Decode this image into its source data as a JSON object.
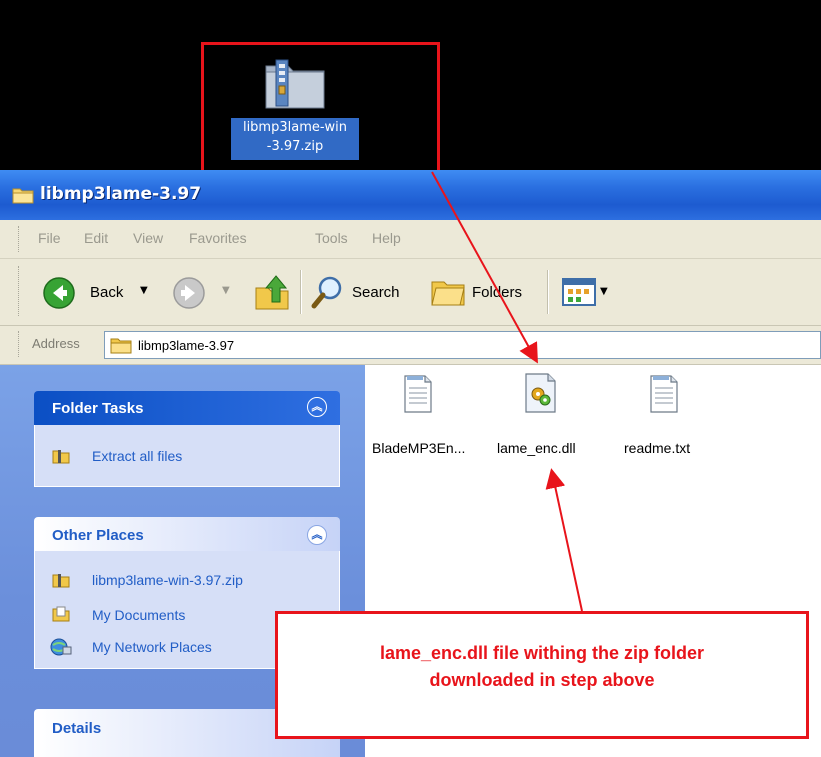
{
  "desktop": {
    "zip_label_line1": "libmp3lame-win",
    "zip_label_line2": "-3.97.zip"
  },
  "window": {
    "title": "libmp3lame-3.97",
    "menu": [
      "File",
      "Edit",
      "View",
      "Favorites",
      "Tools",
      "Help"
    ],
    "toolbar": {
      "back_label": "Back",
      "search_label": "Search",
      "folders_label": "Folders"
    },
    "address": {
      "label": "Address",
      "value": "libmp3lame-3.97"
    }
  },
  "taskpane": {
    "folder_tasks": {
      "title": "Folder Tasks",
      "items": [
        "Extract all files"
      ]
    },
    "other_places": {
      "title": "Other Places",
      "items": [
        "libmp3lame-win-3.97.zip",
        "My Documents",
        "My Network Places"
      ]
    },
    "details": {
      "title": "Details"
    }
  },
  "files": [
    {
      "name": "BladeMP3En...",
      "icon": "text-document-icon"
    },
    {
      "name": "lame_enc.dll",
      "icon": "dll-file-icon"
    },
    {
      "name": "readme.txt",
      "icon": "text-document-icon"
    }
  ],
  "callout": {
    "line1": "lame_enc.dll file withing the zip folder",
    "line2": "downloaded in step above"
  },
  "colors": {
    "annotation_red": "#e8141b",
    "xp_title_blue": "#2a6fe0",
    "selection_blue": "#316ac5",
    "link_blue": "#215dc6"
  }
}
